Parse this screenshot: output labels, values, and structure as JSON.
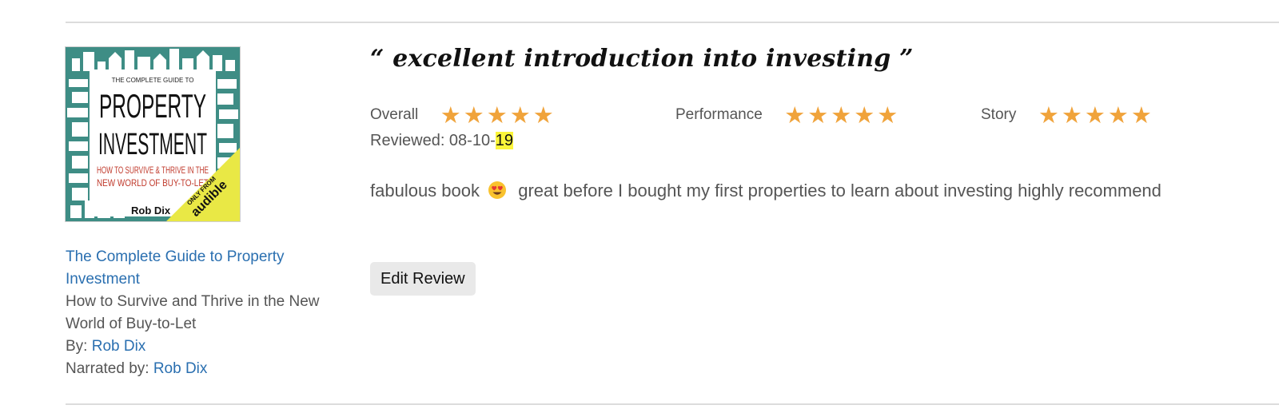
{
  "review": {
    "headline": "“ excellent introduction into investing ”",
    "ratings": [
      {
        "label": "Overall",
        "stars": 5
      },
      {
        "label": "Performance",
        "stars": 5
      },
      {
        "label": "Story",
        "stars": 5
      }
    ],
    "reviewed_prefix": "Reviewed: 08-10-",
    "reviewed_highlight": "19",
    "body_before_emoji": "fabulous book",
    "emoji_icon": "heart-eyes-emoji-icon",
    "body_after_emoji": "great before I bought my first properties to learn about investing highly recommend",
    "edit_label": "Edit Review"
  },
  "book": {
    "cover_top": "THE COMPLETE GUIDE TO",
    "cover_title_1": "PROPERTY",
    "cover_title_2": "INVESTMENT",
    "cover_sub_1": "HOW TO SURVIVE & THRIVE IN THE",
    "cover_sub_2": "NEW WORLD OF BUY-TO-LET",
    "cover_author": "Rob Dix",
    "cover_badge_1": "ONLY FROM",
    "cover_badge_2": "audible",
    "title": "The Complete Guide to Property Investment",
    "subtitle": "How to Survive and Thrive in the New World of Buy-to-Let",
    "by_label": "By:",
    "author": "Rob Dix",
    "narrated_label": "Narrated by:",
    "narrator": "Rob Dix"
  },
  "colors": {
    "star": "#f0a33b",
    "link": "#2a6fb0",
    "highlight": "#fbf53a",
    "cover_bg": "#3e8d85",
    "badge": "#e9e845"
  }
}
